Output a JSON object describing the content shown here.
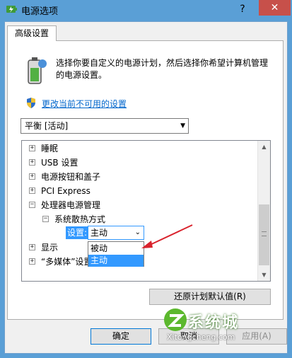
{
  "window": {
    "title": "电源选项",
    "help": "?",
    "close": "✕"
  },
  "tab": {
    "label": "高级设置"
  },
  "description": "选择你要自定义的电源计划，然后选择你希望计算机管理的电源设置。",
  "link": "更改当前不可用的设置",
  "plan_select": {
    "value": "平衡 [活动]"
  },
  "tree": {
    "items": [
      "睡眠",
      "USB 设置",
      "电源按钮和盖子",
      "PCI Express",
      "处理器电源管理",
      "系统散热方式",
      "显示",
      "“多媒体”设置"
    ],
    "expanders": [
      "+",
      "+",
      "+",
      "+",
      "+",
      "−",
      "−",
      "+",
      "+"
    ]
  },
  "setting": {
    "label": "设置:",
    "value": "主动",
    "options": [
      "被动",
      "主动"
    ],
    "selected_index": 1
  },
  "buttons": {
    "restore": "还原计划默认值(R)",
    "ok": "确定",
    "cancel": "取消",
    "apply": "应用(A)"
  },
  "watermark": {
    "text": "系统城",
    "url": "Xitongcheng.com"
  },
  "colors": {
    "desktop": "#5a9fd6",
    "close": "#c7504a",
    "link": "#0066cc",
    "selection": "#3399ff",
    "arrow": "#d9232d"
  }
}
